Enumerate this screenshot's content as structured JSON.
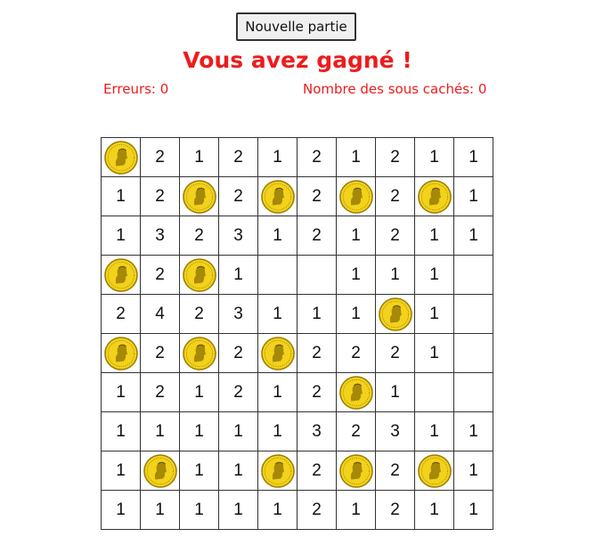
{
  "controls": {
    "new_game_label": "Nouvelle partie"
  },
  "status": {
    "message": "Vous avez gagné !",
    "errors_text": "Erreurs: 0",
    "hidden_coins_text": "Nombre des sous cachés: 0"
  },
  "colors": {
    "status_red": "#ee1c1c",
    "coin_gold": "#f2d21a",
    "coin_rim": "#9a7d06"
  },
  "icons": {
    "coin": "gold-coin-icon"
  },
  "board": {
    "rows": 10,
    "cols": 10,
    "cells": [
      [
        "C",
        "2",
        "1",
        "2",
        "1",
        "2",
        "1",
        "2",
        "1",
        "1"
      ],
      [
        "1",
        "2",
        "C",
        "2",
        "C",
        "2",
        "C",
        "2",
        "C",
        "1"
      ],
      [
        "1",
        "3",
        "2",
        "3",
        "1",
        "2",
        "1",
        "2",
        "1",
        "1"
      ],
      [
        "C",
        "2",
        "C",
        "1",
        "",
        "",
        "1",
        "1",
        "1",
        ""
      ],
      [
        "2",
        "4",
        "2",
        "3",
        "1",
        "1",
        "1",
        "C",
        "1",
        ""
      ],
      [
        "C",
        "2",
        "C",
        "2",
        "C",
        "2",
        "2",
        "2",
        "1",
        ""
      ],
      [
        "1",
        "2",
        "1",
        "2",
        "1",
        "2",
        "C",
        "1",
        "",
        ""
      ],
      [
        "1",
        "1",
        "1",
        "1",
        "1",
        "3",
        "2",
        "3",
        "1",
        "1"
      ],
      [
        "1",
        "C",
        "1",
        "1",
        "C",
        "2",
        "C",
        "2",
        "C",
        "1"
      ],
      [
        "1",
        "1",
        "1",
        "1",
        "1",
        "2",
        "1",
        "2",
        "1",
        "1"
      ]
    ]
  }
}
